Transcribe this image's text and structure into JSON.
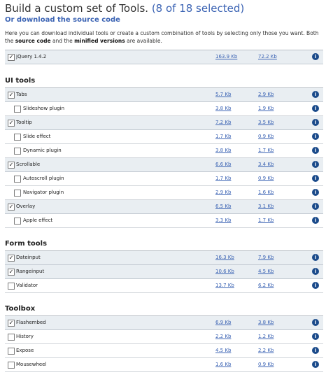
{
  "header": {
    "title": "Build a custom set of Tools.",
    "selected_count": "(8 of 18 selected)",
    "download_link": "Or download the source code"
  },
  "intro": {
    "text_before": "Here you can download individual tools or create a custom combination of tools by selecting only those you want. Both the ",
    "source_code": "source code",
    "text_middle": " and the ",
    "minified": "minified versions",
    "text_after": " are available."
  },
  "jquery": {
    "name": "jQuery 1.4.2",
    "size": "163.9 Kb",
    "min": "72.2 Kb",
    "checked": true
  },
  "sections": [
    {
      "title": "UI tools",
      "rows": [
        {
          "name": "Tabs",
          "size": "5.7 Kb",
          "min": "2.9 Kb",
          "checked": true,
          "level": "top"
        },
        {
          "name": "Slideshow plugin",
          "size": "3.8 Kb",
          "min": "1.9 Kb",
          "checked": false,
          "level": "child"
        },
        {
          "name": "Tooltip",
          "size": "7.2 Kb",
          "min": "3.5 Kb",
          "checked": true,
          "level": "top"
        },
        {
          "name": "Slide effect",
          "size": "1.7 Kb",
          "min": "0.9 Kb",
          "checked": false,
          "level": "child"
        },
        {
          "name": "Dynamic plugin",
          "size": "3.8 Kb",
          "min": "1.7 Kb",
          "checked": false,
          "level": "child"
        },
        {
          "name": "Scrollable",
          "size": "6.6 Kb",
          "min": "3.4 Kb",
          "checked": true,
          "level": "top"
        },
        {
          "name": "Autoscroll plugin",
          "size": "1.7 Kb",
          "min": "0.9 Kb",
          "checked": false,
          "level": "child"
        },
        {
          "name": "Navigator plugin",
          "size": "2.9 Kb",
          "min": "1.6 Kb",
          "checked": false,
          "level": "child"
        },
        {
          "name": "Overlay",
          "size": "6.5 Kb",
          "min": "3.1 Kb",
          "checked": true,
          "level": "top"
        },
        {
          "name": "Apple effect",
          "size": "3.3 Kb",
          "min": "1.7 Kb",
          "checked": false,
          "level": "child"
        }
      ]
    },
    {
      "title": "Form tools",
      "rows": [
        {
          "name": "Dateinput",
          "size": "16.3 Kb",
          "min": "7.9 Kb",
          "checked": true,
          "level": "top"
        },
        {
          "name": "Rangeinput",
          "size": "10.6 Kb",
          "min": "4.5 Kb",
          "checked": true,
          "level": "top"
        },
        {
          "name": "Validator",
          "size": "13.7 Kb",
          "min": "6.2 Kb",
          "checked": false,
          "level": "top"
        }
      ]
    },
    {
      "title": "Toolbox",
      "rows": [
        {
          "name": "Flashembed",
          "size": "6.9 Kb",
          "min": "3.8 Kb",
          "checked": true,
          "level": "top"
        },
        {
          "name": "History",
          "size": "2.2 Kb",
          "min": "1.2 Kb",
          "checked": false,
          "level": "top"
        },
        {
          "name": "Expose",
          "size": "4.5 Kb",
          "min": "2.2 Kb",
          "checked": false,
          "level": "top"
        },
        {
          "name": "Mousewheel",
          "size": "1.6 Kb",
          "min": "0.9 Kb",
          "checked": false,
          "level": "top"
        }
      ]
    }
  ],
  "colors": {
    "link": "#3c64b4",
    "selected_row": "#e9eef2",
    "info_icon": "#1a4a8a"
  },
  "icons": {
    "checkbox": "checkbox-icon",
    "info": "info-icon"
  }
}
